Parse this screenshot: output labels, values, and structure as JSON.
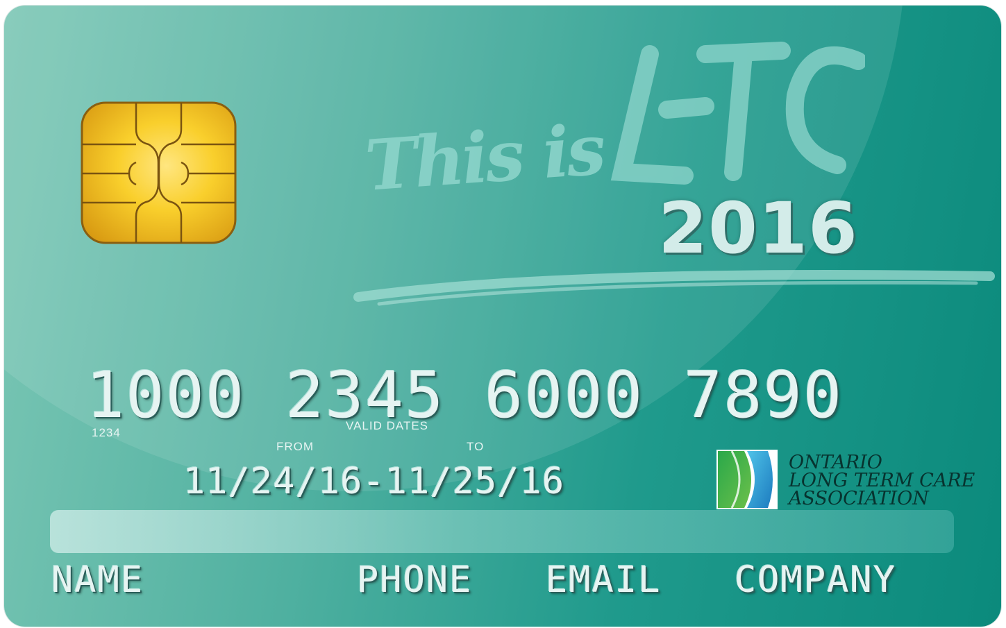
{
  "card": {
    "logo_text": "This is",
    "logo_big": "LTC",
    "year": "2016",
    "card_number": "1000 2345 6000 7890",
    "small_code": "1234",
    "valid_dates_label": "VALID DATES",
    "from_label": "FROM",
    "to_label": "TO",
    "valid_dates_value": "11/24/16-11/25/16",
    "association": {
      "line1": "ONTARIO",
      "line2": "LONG TERM CARE",
      "line3": "ASSOCIATION"
    },
    "fields": {
      "name": "NAME",
      "phone": "PHONE",
      "email": "EMAIL",
      "company": "COMPANY"
    }
  },
  "colors": {
    "card_start": "#7cc7b5",
    "card_end": "#0b8a7c",
    "chip_gold": "#f7c21e",
    "embossed_text": "#e6f4f2",
    "association_text": "#07332f"
  },
  "icons": {
    "chip": "emv-chip-icon",
    "association_logo": "oltca-logo-icon"
  }
}
